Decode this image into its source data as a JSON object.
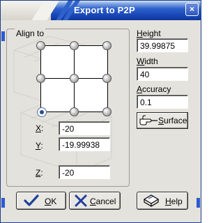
{
  "window": {
    "title": "Export to P2P",
    "close_glyph": "×"
  },
  "align_group": {
    "label": "Align to",
    "selected_anchor": "bottom-left",
    "x_label": "X",
    "x_suffix": ":",
    "x_value": "-20",
    "y_label": "Y",
    "y_suffix": ":",
    "y_value": "-19.99938",
    "z_label": "Z",
    "z_suffix": ":",
    "z_value": "-20"
  },
  "dimensions": {
    "height_label_mn": "H",
    "height_label_rest": "eight",
    "height_value": "39.99875",
    "width_label_mn": "W",
    "width_label_rest": "idth",
    "width_value": "40",
    "accuracy_label_mn": "A",
    "accuracy_label_rest": "ccuracy",
    "accuracy_value": "0.1",
    "surface_label_mn": "S",
    "surface_label_rest": "urface"
  },
  "buttons": {
    "ok_mn": "O",
    "ok_rest": "K",
    "cancel_mn": "C",
    "cancel_rest": "ancel",
    "help_mn": "H",
    "help_rest": "elp"
  },
  "icons": {
    "ok": "checkmark-icon",
    "cancel": "x-mark-icon",
    "help": "help-book-icon",
    "surface": "pointing-hand-icon",
    "close": "close-icon",
    "anchor_handle": "anchor-knob-icon"
  },
  "colors": {
    "titlebar_blue": "#1846b6",
    "window_bg": "#e4e2dc",
    "accent_blue": "#2d5ad0",
    "ok_check": "#1f3f9e",
    "cancel_x": "#1f3f9e"
  }
}
